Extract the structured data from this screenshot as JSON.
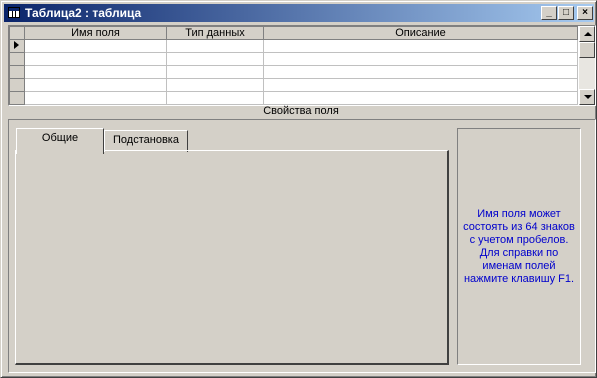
{
  "window": {
    "title": "Таблица2 : таблица"
  },
  "titlebar_buttons": {
    "minimize": "_",
    "maximize": "□",
    "close": "×"
  },
  "grid": {
    "columns": [
      "Имя поля",
      "Тип данных",
      "Описание"
    ],
    "rows": [
      [
        "",
        "",
        ""
      ],
      [
        "",
        "",
        ""
      ],
      [
        "",
        "",
        ""
      ],
      [
        "",
        "",
        ""
      ],
      [
        "",
        "",
        ""
      ]
    ]
  },
  "properties": {
    "label": "Свойства поля",
    "tabs": [
      {
        "label": "Общие",
        "active": true
      },
      {
        "label": "Подстановка",
        "active": false
      }
    ],
    "help_text": "Имя поля может\nсостоять из 64 знаков\nс учетом пробелов.\nДля справки по\nименам полей\nнажмите клавишу F1."
  }
}
